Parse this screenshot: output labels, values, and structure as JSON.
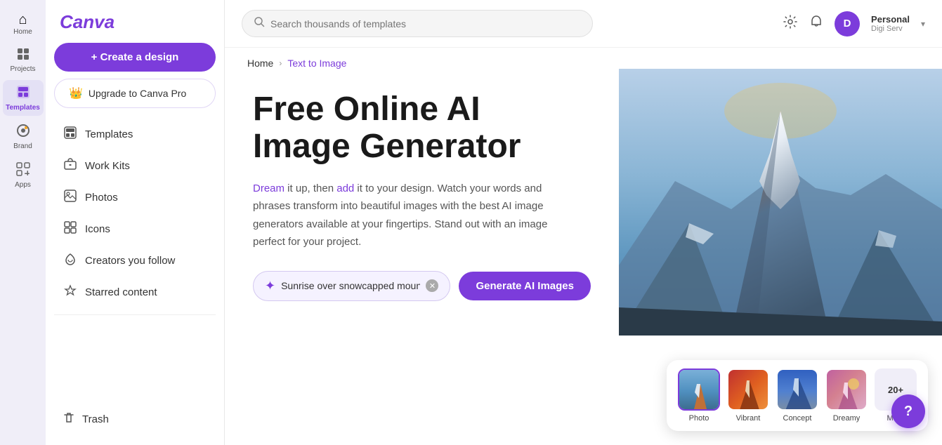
{
  "app": {
    "name": "Canva",
    "logo": "Canva"
  },
  "iconNav": {
    "items": [
      {
        "id": "home",
        "label": "Home",
        "icon": "⌂"
      },
      {
        "id": "projects",
        "label": "Projects",
        "icon": "⊞"
      },
      {
        "id": "templates",
        "label": "Templates",
        "icon": "▦",
        "active": true
      },
      {
        "id": "brand",
        "label": "Brand",
        "icon": "◉"
      },
      {
        "id": "apps",
        "label": "Apps",
        "icon": "⊡"
      }
    ]
  },
  "sidebar": {
    "createButton": "+ Create a design",
    "upgradeButton": "Upgrade to Canva Pro",
    "items": [
      {
        "id": "templates",
        "label": "Templates",
        "icon": "☰"
      },
      {
        "id": "workkits",
        "label": "Work Kits",
        "icon": "⊕"
      },
      {
        "id": "photos",
        "label": "Photos",
        "icon": "⬜"
      },
      {
        "id": "icons",
        "label": "Icons",
        "icon": "❖"
      },
      {
        "id": "creators",
        "label": "Creators you follow",
        "icon": "♡"
      },
      {
        "id": "starred",
        "label": "Starred content",
        "icon": "☆"
      }
    ],
    "trashLabel": "Trash",
    "trashIcon": "🗑"
  },
  "topbar": {
    "searchPlaceholder": "Search thousands of templates",
    "user": {
      "initial": "D",
      "name": "Personal",
      "sub": "Digi Serv"
    }
  },
  "breadcrumb": {
    "home": "Home",
    "separator": "›",
    "current": "Text to Image"
  },
  "hero": {
    "heading1": "Free Online AI",
    "heading2": "Image Generator",
    "description": "Dream it up, then add it to your design. Watch your words and phrases transform into beautiful images with the best AI image generators available at your fingertips. Stand out with an image perfect for your project.",
    "promptValue": "Sunrise over snowcapped moun",
    "promptPlaceholder": "Sunrise over snowcapped moun",
    "generateLabel": "Generate AI Images"
  },
  "styles": {
    "items": [
      {
        "id": "photo",
        "label": "Photo",
        "active": true,
        "gradient": "linear-gradient(135deg, #4a7db5 0%, #8ab0d0 40%, #c0d8e8 60%, #ffffff 80%)"
      },
      {
        "id": "vibrant",
        "label": "Vibrant",
        "gradient": "linear-gradient(135deg, #c03030 0%, #e06020 30%, #f09040 60%, #ffc060 80%)"
      },
      {
        "id": "concept",
        "label": "Concept",
        "gradient": "linear-gradient(135deg, #3060c0 0%, #5080d0 30%, #a0c0e0 60%, #c0d8f0 80%)"
      },
      {
        "id": "dreamy",
        "label": "Dreamy",
        "gradient": "linear-gradient(135deg, #c060a0 0%, #d080b0 30%, #e0a0c0 60%, #f0c8e0 80%)"
      }
    ],
    "moreLabel": "20+",
    "moreSubLabel": "More"
  },
  "helpButton": "?"
}
